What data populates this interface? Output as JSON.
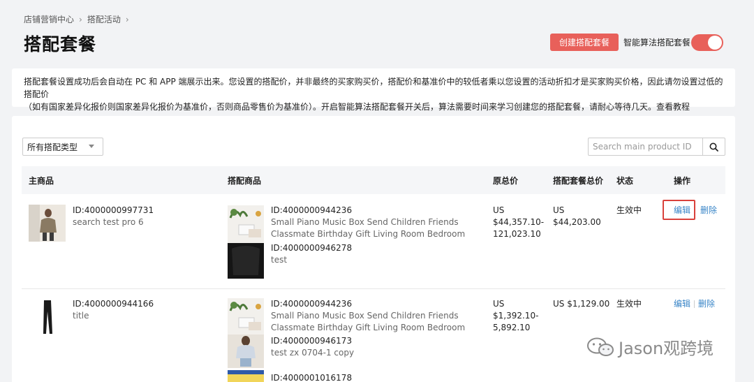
{
  "breadcrumb": {
    "items": [
      "店铺营销中心",
      "搭配活动"
    ],
    "sep_icon": "chevron-right"
  },
  "page_title": "搭配套餐",
  "header": {
    "create_button": "创建搭配套餐",
    "smart_label": "智能算法搭配套餐",
    "smart_toggle_on": true,
    "accent_color": "#e8605a"
  },
  "notice": {
    "line1": "搭配套餐设置成功后会自动在 PC 和 APP 端展示出来。您设置的搭配价，并非最终的买家购买价，搭配价和基准价中的较低者乘以您设置的活动折扣才是买家购买价格，因此请勿设置过低的搭配价",
    "line2": "（如有国家差异化报价则国家差异化报价为基准价，否则商品零售价为基准价）。开启智能算法搭配套餐开关后，算法需要时间来学习创建您的搭配套餐，请耐心等待几天。",
    "link": "查看教程"
  },
  "filters": {
    "type_select": "所有搭配类型",
    "search_placeholder": "Search main product ID"
  },
  "table": {
    "headers": {
      "main": "主商品",
      "bundle": "搭配商品",
      "original": "原总价",
      "bundle_total": "搭配套餐总价",
      "status": "状态",
      "action": "操作"
    },
    "rows": [
      {
        "main_id": "ID:4000000997731",
        "main_name": "search test pro 6",
        "items": [
          {
            "id": "ID:4000000944236",
            "name1": "Small Piano Music Box Send Children Friends",
            "name2": "Classmate Birthday Gift Living Room Bedroom"
          },
          {
            "id": "ID:4000000946278",
            "name1": "test"
          }
        ],
        "original_price": [
          "US",
          "$44,357.10-",
          "121,023.10"
        ],
        "bundle_price": [
          "US",
          "$44,203.00"
        ],
        "status": "生效中",
        "edit": "编辑",
        "delete": "删除"
      },
      {
        "main_id": "ID:4000000944166",
        "main_name": "title",
        "items": [
          {
            "id": "ID:4000000944236",
            "name1": "Small Piano Music Box Send Children Friends",
            "name2": "Classmate Birthday Gift Living Room Bedroom"
          },
          {
            "id": "ID:4000000946173",
            "name1": "test zx 0704-1 copy"
          },
          {
            "id": "ID:4000001016178"
          }
        ],
        "original_price": [
          "US",
          "$1,392.10-",
          "5,892.10"
        ],
        "bundle_price": [
          "US $1,129.00"
        ],
        "status": "生效中",
        "edit": "编辑",
        "delete": "删除"
      }
    ]
  },
  "watermark": "Jason观跨境"
}
